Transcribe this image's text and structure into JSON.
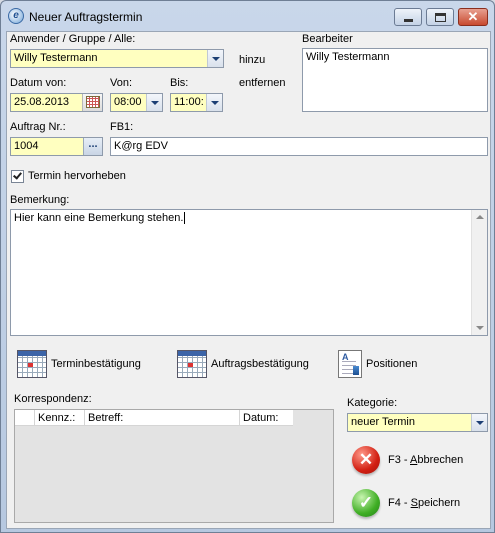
{
  "window": {
    "title": "Neuer Auftragstermin",
    "icon": "ie-app-icon"
  },
  "labels": {
    "anwender": "Anwender / Gruppe / Alle:",
    "bearbeiter": "Bearbeiter",
    "hinzu": "hinzu",
    "entfernen": "entfernen",
    "datum_von": "Datum von:",
    "von": "Von:",
    "bis": "Bis:",
    "auftrag_nr": "Auftrag Nr.:",
    "fb1": "FB1:",
    "termin_hervorheben": "Termin hervorheben",
    "bemerkung": "Bemerkung:",
    "korrespondenz": "Korrespondenz:",
    "kategorie": "Kategorie:"
  },
  "fields": {
    "anwender_value": "Willy Testermann",
    "bearbeiter_list": [
      "Willy Testermann"
    ],
    "datum_von": "25.08.2013",
    "von": "08:00",
    "bis": "11:00:",
    "auftrag_nr": "1004",
    "auftrag_btn": "...",
    "fb1": "K@rg EDV",
    "termin_hervorheben_checked": true,
    "bemerkung": "Hier kann eine Bemerkung stehen.",
    "kategorie": "neuer Termin"
  },
  "buttons": {
    "terminbestaetigung": "Terminbestätigung",
    "auftragsbestaetigung": "Auftragsbestätigung",
    "positionen": "Positionen",
    "abbrechen_prefix": "F3 - ",
    "abbrechen_accel": "A",
    "abbrechen_rest": "bbrechen",
    "speichern_prefix": "F4 - ",
    "speichern_accel": "S",
    "speichern_rest": "peichern"
  },
  "korrespondenz_columns": [
    "Kennz.:",
    "Betreff:",
    "Datum:"
  ],
  "colors": {
    "highlight_field": "#ffffc0",
    "accent": "#3b64a8"
  }
}
